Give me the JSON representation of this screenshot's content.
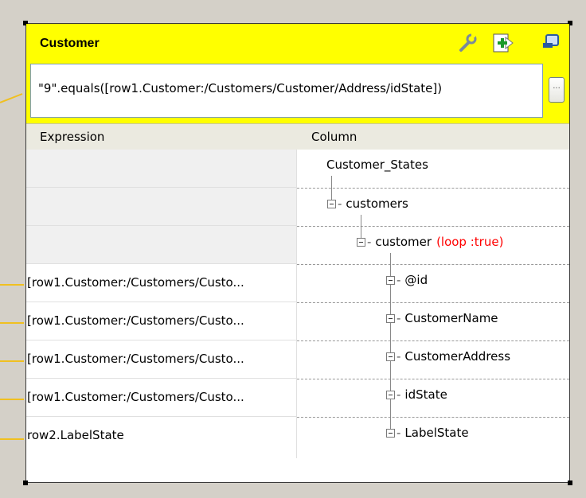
{
  "table": {
    "name": "Customer",
    "filter_expression": "\"9\".equals([row1.Customer:/Customers/Customer/Address/idState])",
    "dots_label": "...",
    "icons": [
      "wrench-icon",
      "add-column-icon",
      "minimize-icon"
    ]
  },
  "columns": {
    "expression": "Expression",
    "column": "Column"
  },
  "expressions": [
    "",
    "",
    "",
    "[row1.Customer:/Customers/Custo...",
    "[row1.Customer:/Customers/Custo...",
    "[row1.Customer:/Customers/Custo...",
    "[row1.Customer:/Customers/Custo...",
    "row2.LabelState"
  ],
  "tree": {
    "root": "Customer_States",
    "customers": "customers",
    "customer": "customer",
    "loop_label": "(loop :true)",
    "fields": [
      "@id",
      "CustomerName",
      "CustomerAddress",
      "idState",
      "LabelState"
    ]
  },
  "colors": {
    "header_bg": "#ffff00",
    "loop_text": "#ff0000",
    "link_arrow": "#f0c020"
  }
}
